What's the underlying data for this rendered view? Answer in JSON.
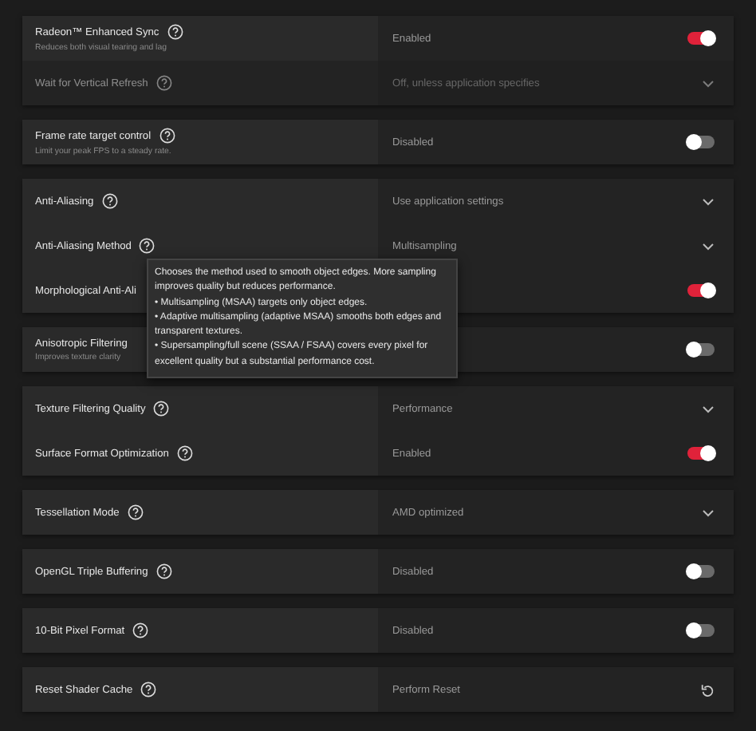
{
  "groups": [
    {
      "rows": [
        {
          "kind": "toggle",
          "label": "Radeon™ Enhanced Sync",
          "help": true,
          "subtitle": "Reduces both visual tearing and lag",
          "value": "Enabled",
          "on": true,
          "disabled": false
        },
        {
          "kind": "dropdown",
          "label": "Wait for Vertical Refresh",
          "help": true,
          "value": "Off, unless application specifies",
          "disabled": true
        }
      ]
    },
    {
      "rows": [
        {
          "kind": "toggle",
          "label": "Frame rate target control",
          "help": true,
          "subtitle": "Limit your peak FPS to a steady rate.",
          "value": "Disabled",
          "on": false,
          "disabled": false
        }
      ]
    },
    {
      "rows": [
        {
          "kind": "dropdown",
          "label": "Anti-Aliasing",
          "help": true,
          "value": "Use application settings",
          "disabled": false
        },
        {
          "kind": "dropdown",
          "label": "Anti-Aliasing Method",
          "help": true,
          "value": "Multisampling",
          "disabled": false,
          "tooltip": [
            "Chooses the method used to smooth object edges. More sampling improves quality but reduces performance.",
            "• Multisampling (MSAA) targets only object edges.",
            "• Adaptive multisampling (adaptive MSAA) smooths both edges and transparent textures.",
            "• Supersampling/full scene (SSAA / FSAA) covers every pixel for excellent quality but a substantial performance cost."
          ]
        },
        {
          "kind": "toggle",
          "label": "Morphological Anti-Ali",
          "help": false,
          "on": true,
          "disabled": false
        }
      ]
    },
    {
      "rows": [
        {
          "kind": "toggle",
          "label": "Anisotropic Filtering",
          "help": false,
          "subtitle": "Improves texture clarity",
          "on": false,
          "disabled": false
        }
      ]
    },
    {
      "rows": [
        {
          "kind": "dropdown",
          "label": "Texture Filtering Quality",
          "help": true,
          "value": "Performance",
          "disabled": false
        },
        {
          "kind": "toggle",
          "label": "Surface Format Optimization",
          "help": true,
          "value": "Enabled",
          "on": true,
          "disabled": false
        }
      ]
    },
    {
      "rows": [
        {
          "kind": "dropdown",
          "label": "Tessellation Mode",
          "help": true,
          "value": "AMD optimized",
          "disabled": false
        }
      ]
    },
    {
      "rows": [
        {
          "kind": "toggle",
          "label": "OpenGL Triple Buffering",
          "help": true,
          "value": "Disabled",
          "on": false,
          "disabled": false
        }
      ]
    },
    {
      "rows": [
        {
          "kind": "toggle",
          "label": "10-Bit Pixel Format",
          "help": true,
          "value": "Disabled",
          "on": false,
          "disabled": false
        }
      ]
    },
    {
      "rows": [
        {
          "kind": "action",
          "label": "Reset Shader Cache",
          "help": true,
          "value": "Perform Reset",
          "disabled": false
        }
      ]
    }
  ]
}
